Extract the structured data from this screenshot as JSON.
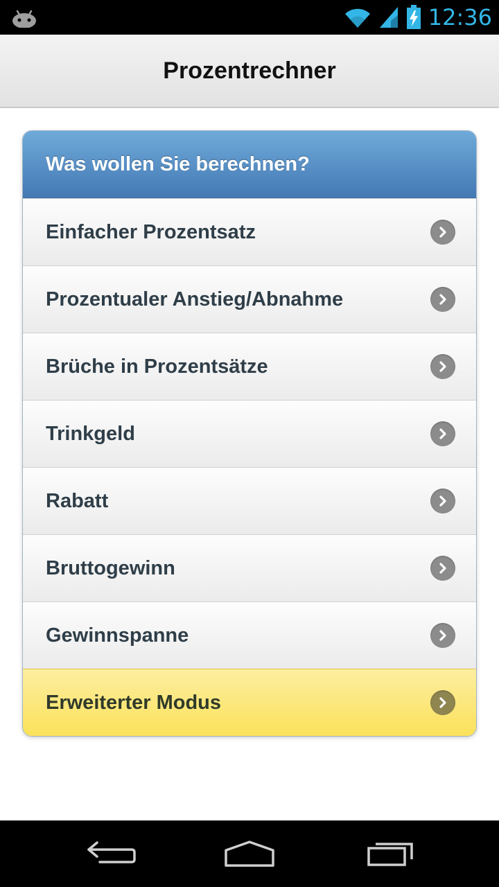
{
  "status_bar": {
    "time": "12:36",
    "icons": [
      "android-icon",
      "wifi-icon",
      "signal-icon",
      "battery-charging-icon"
    ],
    "clock_color": "#33b5e5"
  },
  "header": {
    "title": "Prozentrechner"
  },
  "panel": {
    "title": "Was wollen Sie berechnen?",
    "header_color": "#4f86bf",
    "items": [
      {
        "label": "Einfacher Prozentsatz"
      },
      {
        "label": "Prozentualer Anstieg/Abnahme"
      },
      {
        "label": "Brüche in Prozentsätze"
      },
      {
        "label": "Trinkgeld"
      },
      {
        "label": "Rabatt"
      },
      {
        "label": "Bruttogewinn"
      },
      {
        "label": "Gewinnspanne"
      },
      {
        "label": "Erweiterter Modus",
        "highlight_color": "#fbe15a"
      }
    ]
  },
  "nav_bar": {
    "buttons": [
      "back-icon",
      "home-icon",
      "recent-apps-icon"
    ]
  }
}
